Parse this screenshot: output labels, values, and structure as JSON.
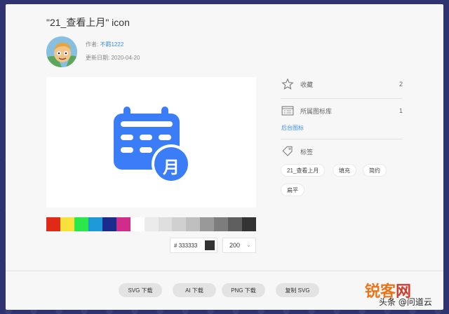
{
  "dialog": {
    "title": "\"21_查看上月\" icon"
  },
  "author": {
    "label": "作者:",
    "name": "不羁1222",
    "date_label": "更新日期:",
    "date": "2020-04-20"
  },
  "preview": {
    "icon_name": "calendar-month-icon",
    "icon_color": "#3a7df6",
    "badge_text": "月"
  },
  "palette": [
    "#e02a17",
    "#f7e13a",
    "#2be84a",
    "#1e98d8",
    "#1b2d8c",
    "#d02c8c",
    "#ffffff",
    "#ebebeb",
    "#dedede",
    "#d0d0d0",
    "#bfbfbf",
    "#999999",
    "#7d7d7d",
    "#5f5f5f",
    "#333333"
  ],
  "color_picker": {
    "hex_prefix": "#",
    "hex_value": "333333",
    "size_value": "200",
    "selected_color": "#333333"
  },
  "sidebar": {
    "favorite_label": "收藏",
    "favorite_count": "2",
    "library_label": "所属图标库",
    "library_count": "1",
    "library_link": "后台图标",
    "tags_label": "标签",
    "tags": [
      "21_查看上月",
      "填充",
      "简约",
      "扁平"
    ]
  },
  "footer": {
    "buttons": [
      "SVG 下载",
      "AI 下载",
      "PNG 下载",
      "复制 SVG"
    ]
  },
  "watermark": {
    "brand_a": "锐客",
    "brand_b": "网",
    "caption": "头条 @问道云"
  }
}
